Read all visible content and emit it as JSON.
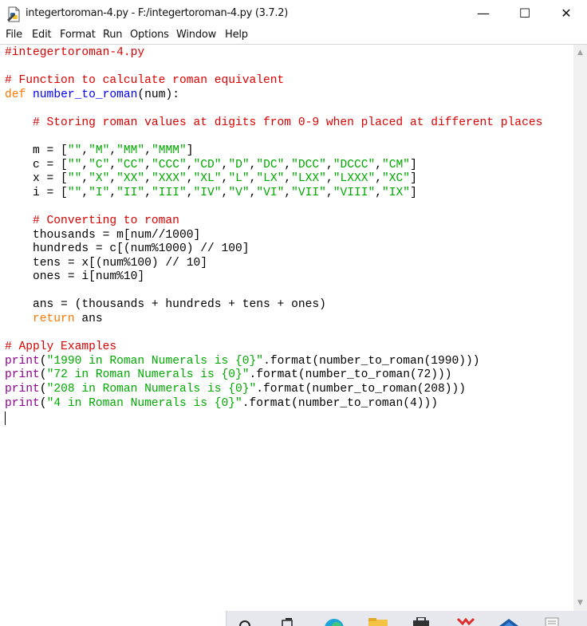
{
  "window": {
    "title": "integertoroman-4.py - F:/integertoroman-4.py (3.7.2)",
    "minimize_glyph": "—",
    "maximize_glyph": "☐",
    "close_glyph": "✕"
  },
  "menu": {
    "file": "File",
    "edit": "Edit",
    "format": "Format",
    "run": "Run",
    "options": "Options",
    "window": "Window",
    "help": "Help"
  },
  "code": {
    "l1": "#integertoroman-4.py",
    "l3": "# Function to calculate roman equivalent",
    "l4_def": "def",
    "l4_name": "number_to_roman",
    "l4_rest": "(num):",
    "l6": "# Storing roman values at digits from 0-9 when placed at different places",
    "m_pre": "m = [",
    "m_items": [
      "\"\"",
      "\"M\"",
      "\"MM\"",
      "\"MMM\""
    ],
    "c_pre": "c = [",
    "c_items": [
      "\"\"",
      "\"C\"",
      "\"CC\"",
      "\"CCC\"",
      "\"CD\"",
      "\"D\"",
      "\"DC\"",
      "\"DCC\"",
      "\"DCCC\"",
      "\"CM\""
    ],
    "x_pre": "x = [",
    "x_items": [
      "\"\"",
      "\"X\"",
      "\"XX\"",
      "\"XXX\"",
      "\"XL\"",
      "\"L\"",
      "\"LX\"",
      "\"LXX\"",
      "\"LXXX\"",
      "\"XC\""
    ],
    "i_pre": "i = [",
    "i_items": [
      "\"\"",
      "\"I\"",
      "\"II\"",
      "\"III\"",
      "\"IV\"",
      "\"V\"",
      "\"VI\"",
      "\"VII\"",
      "\"VIII\"",
      "\"IX\""
    ],
    "close_bracket": "]",
    "comma": ",",
    "l13": "# Converting to roman",
    "l14": "thousands = m[num//1000]",
    "l15": "hundreds = c[(num%1000) // 100]",
    "l16": "tens = x[(num%100) // 10]",
    "l17": "ones = i[num%10]",
    "l19": "ans = (thousands + hundreds + tens + ones)",
    "l20_kw": "return",
    "l20_rest": " ans",
    "l22": "# Apply Examples",
    "print_kw": "print",
    "open_paren": "(",
    "p1_str": "\"1990 in Roman Numerals is {0}\"",
    "p1_rest": ".format(number_to_roman(1990)))",
    "p2_str": "\"72 in Roman Numerals is {0}\"",
    "p2_rest": ".format(number_to_roman(72)))",
    "p3_str": "\"208 in Roman Numerals is {0}\"",
    "p3_rest": ".format(number_to_roman(208)))",
    "p4_str": "\"4 in Roman Numerals is {0}\"",
    "p4_rest": ".format(number_to_roman(4)))"
  },
  "scrollbar": {
    "up_glyph": "▲",
    "down_glyph": "▼"
  },
  "colors": {
    "keyword": "#ff7700",
    "definition": "#0000ff",
    "comment": "#dd0000",
    "string": "#00aa00",
    "builtin": "#900090"
  }
}
